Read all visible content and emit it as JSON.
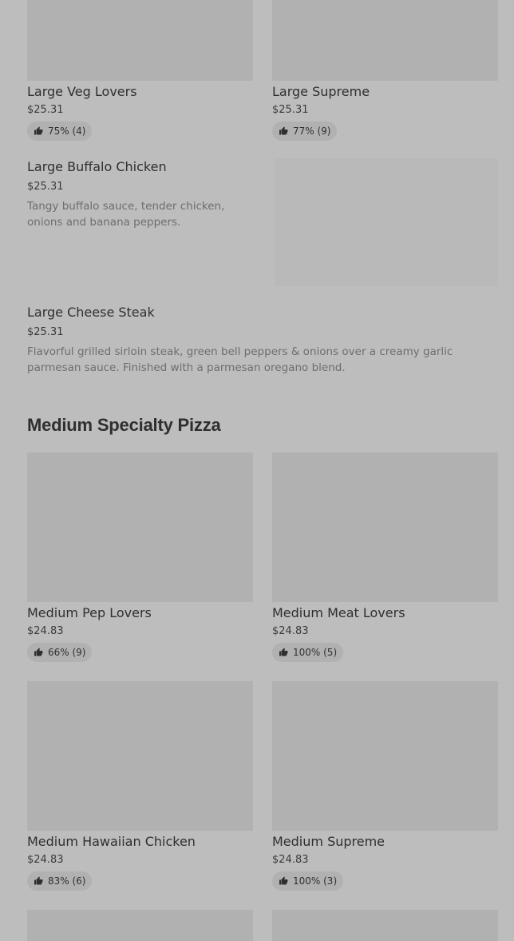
{
  "items_top": [
    {
      "name": "Large Veg Lovers",
      "price": "$25.31",
      "rating": "75% (4)"
    },
    {
      "name": "Large Supreme",
      "price": "$25.31",
      "rating": "77% (9)"
    }
  ],
  "buffalo": {
    "name": "Large Buffalo Chicken",
    "price": "$25.31",
    "description": "Tangy buffalo sauce, tender chicken, onions and banana peppers."
  },
  "cheese_steak": {
    "name": "Large Cheese Steak",
    "price": "$25.31",
    "description": "Flavorful grilled sirloin steak, green bell peppers & onions over a creamy garlic parmesan sauce. Finished with a parmesan oregano blend."
  },
  "section": {
    "title": "Medium Specialty Pizza"
  },
  "medium_items": [
    {
      "name": "Medium Pep Lovers",
      "price": "$24.83",
      "rating": "66% (9)"
    },
    {
      "name": "Medium Meat Lovers",
      "price": "$24.83",
      "rating": "100% (5)"
    },
    {
      "name": "Medium Hawaiian Chicken",
      "price": "$24.83",
      "rating": "83% (6)"
    },
    {
      "name": "Medium Supreme",
      "price": "$24.83",
      "rating": "100% (3)"
    }
  ]
}
